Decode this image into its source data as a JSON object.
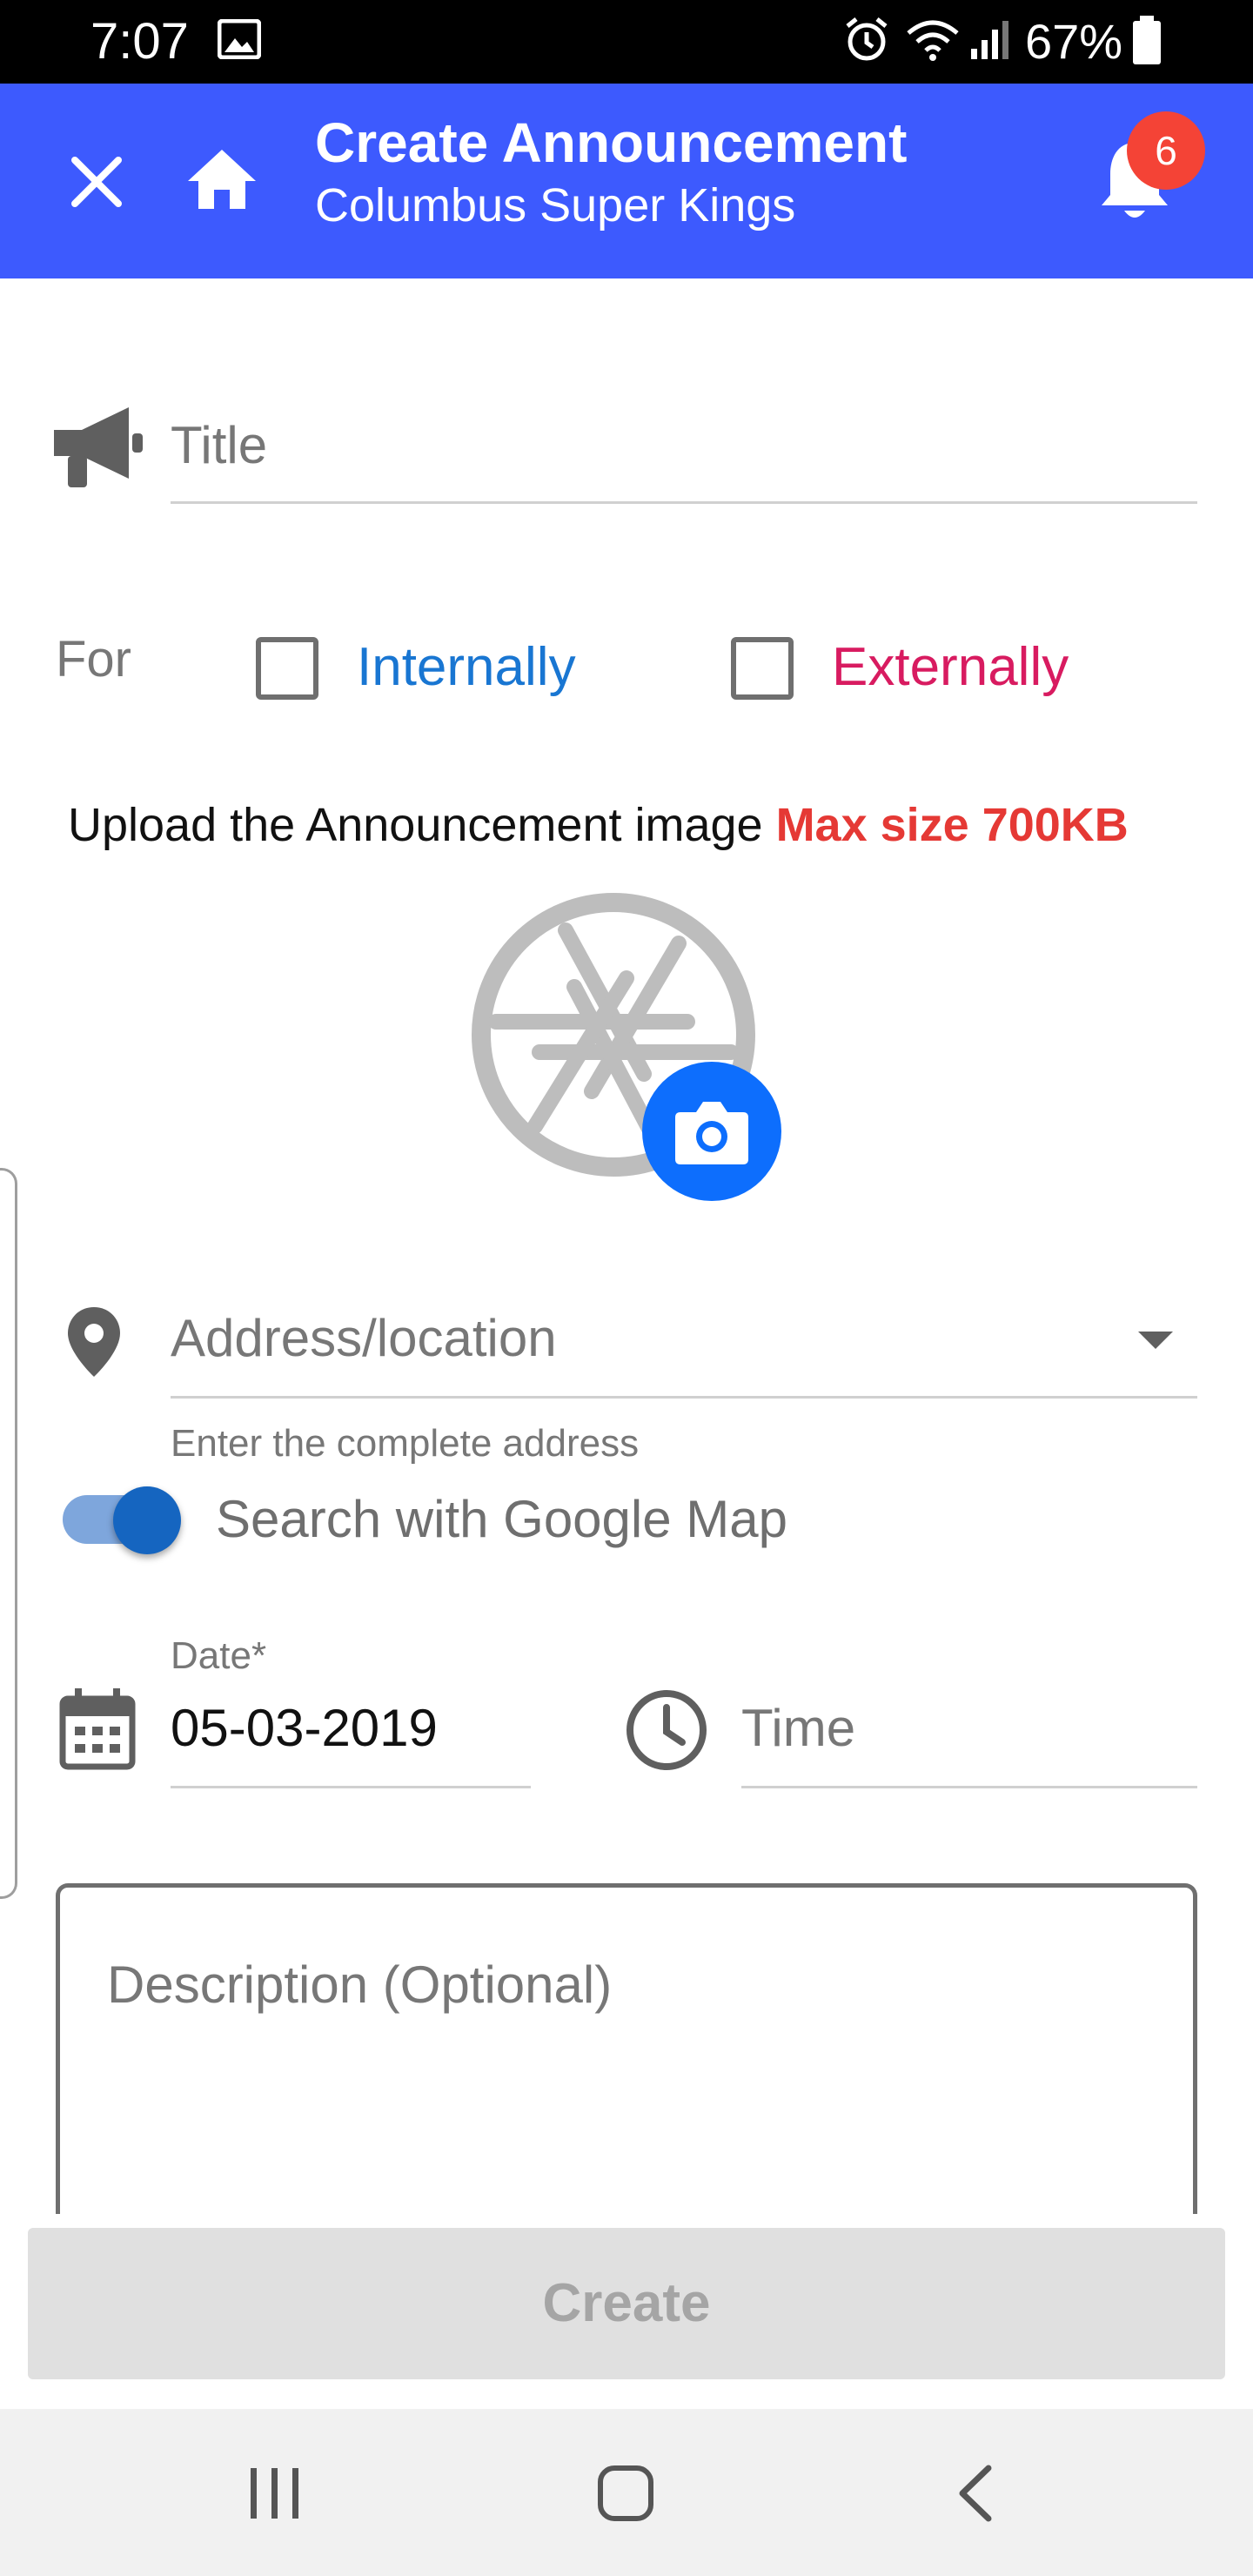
{
  "status_bar": {
    "time": "7:07",
    "battery_percent": "67%",
    "icons": [
      "image-icon",
      "alarm-icon",
      "wifi-icon",
      "signal-icon",
      "battery-icon"
    ]
  },
  "app_bar": {
    "title": "Create Announcement",
    "subtitle": "Columbus Super Kings",
    "notification_count": "6",
    "background_color": "#3d5afe"
  },
  "form": {
    "title_placeholder": "Title",
    "for_label": "For",
    "internally_label": "Internally",
    "externally_label": "Externally",
    "internally_checked": false,
    "externally_checked": false,
    "upload_label": "Upload the Announcement image",
    "upload_max_size": "Max size 700KB",
    "address_placeholder": "Address/location",
    "address_helper": "Enter the complete address",
    "google_map_toggle_label": "Search with Google Map",
    "google_map_toggle_on": true,
    "date_label": "Date*",
    "date_value": "05-03-2019",
    "time_placeholder": "Time",
    "description_placeholder": "Description (Optional)",
    "create_label": "Create"
  },
  "colors": {
    "internally": "#1976d2",
    "externally": "#d81b60",
    "max_size": "#e53935",
    "camera_button": "#0d6efd"
  }
}
